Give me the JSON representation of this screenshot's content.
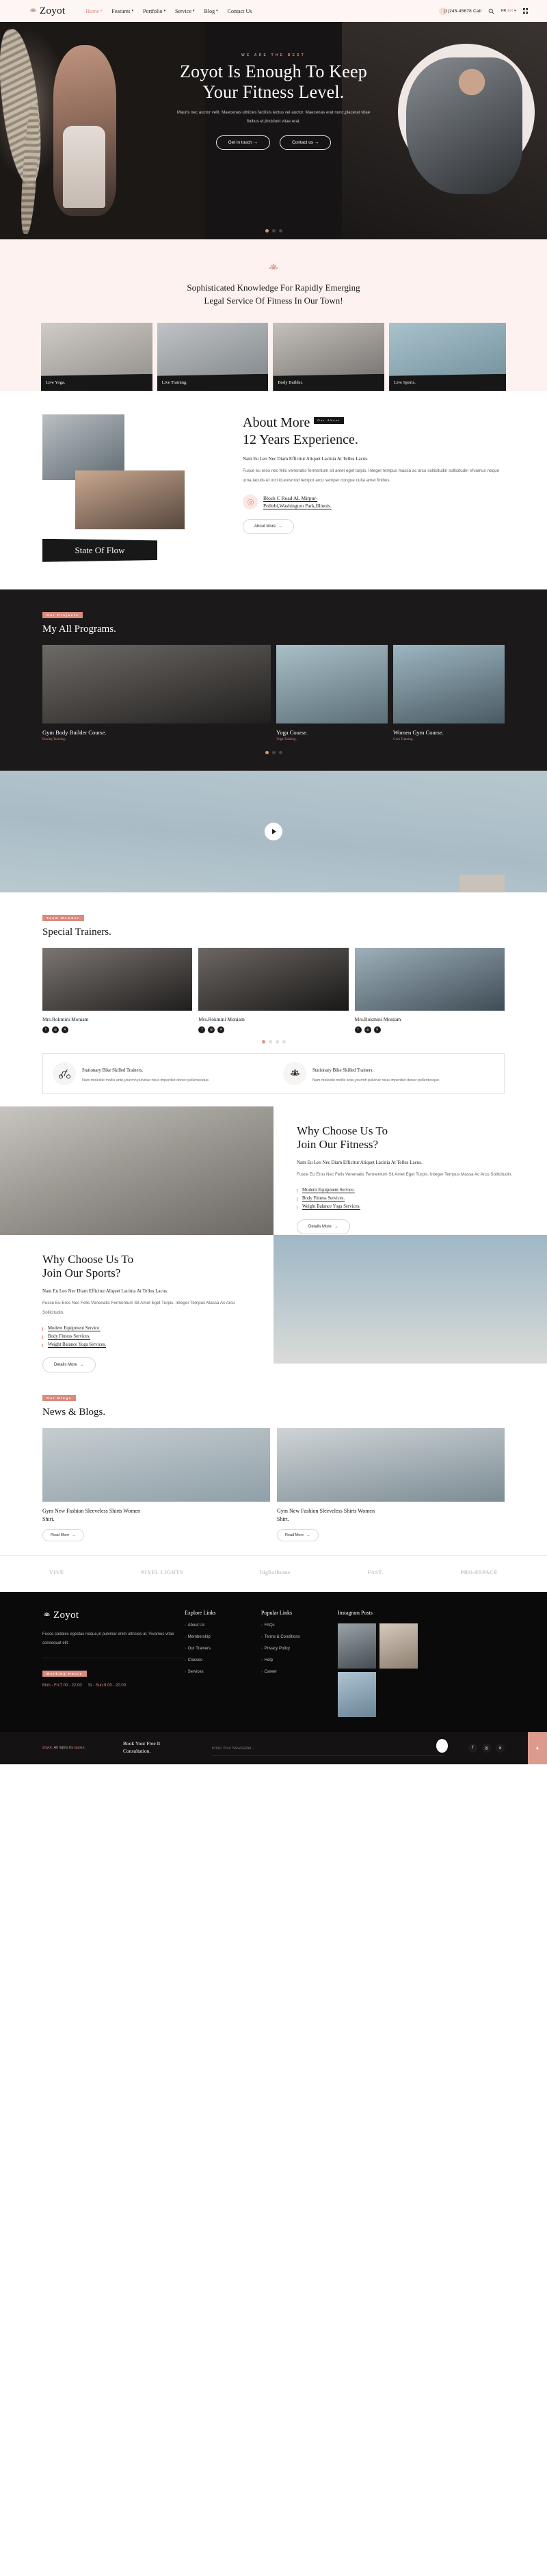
{
  "brand": {
    "name": "Zoyot",
    "logo_icon": "lotus-icon"
  },
  "header": {
    "nav": [
      {
        "label": "Home",
        "caret": "▾",
        "active": true
      },
      {
        "label": "Features",
        "caret": "▾",
        "active": false
      },
      {
        "label": "Portfolio",
        "caret": "▾",
        "active": false
      },
      {
        "label": "Service",
        "caret": "▾",
        "active": false
      },
      {
        "label": "Blog",
        "caret": "▾",
        "active": false
      },
      {
        "label": "Contact Us",
        "caret": "",
        "active": false
      }
    ],
    "phone": "(1)245-45678 Call",
    "search_icon": "search-icon",
    "lang_primary": "FR",
    "lang_secondary": "EN",
    "lang_caret": "▾",
    "grid_icon": "grid-menu-icon"
  },
  "hero": {
    "eyebrow": "WE ARE THE BEST",
    "title_line1": "Zoyot Is Enough To Keep",
    "title_line2": "Your Fitness Level.",
    "subtitle": "Mauris nec auctor velit. Maecenas ultricies facilisis lectus vel auctor. Maecenas erat nunc,placerat vitae finibus et,tincidunt vitae erat.",
    "btn_primary": "Get in touch",
    "btn_secondary": "Contact us",
    "arrow": "→",
    "slides": 3,
    "active_slide": 0
  },
  "knowledge": {
    "icon": "lotus-icon",
    "title_line1": "Sophisticated Knowledge For Rapidly Emerging",
    "title_line2": "Legal Service Of Fitness In Our Town!",
    "cards": [
      {
        "label": "Live Yoga."
      },
      {
        "label": "Live Training."
      },
      {
        "label": "Body Builder."
      },
      {
        "label": "Live Sports."
      }
    ]
  },
  "about": {
    "heading_line1": "About More",
    "chip": "Our About",
    "heading_line2": "12 Years Experience.",
    "lead": "Nam Eu Leo Nec Diam Efficitur Aliquet Lacinia At Tellus Lacus.",
    "paragraph": "Fusce eu eros nec felis venenatis fermentum sit amet eget turpis. Integer tempus massa ac arcu sollicitudin sollicitudin Vivamus neque urna,Iaculis et orci id,euismod tempor arcu semper congue nulla amet finibus.",
    "address_icon": "location-send-icon",
    "address_line1": "Block C Road AL Mirpur-",
    "address_line2": "Pollobi,Washington Park,Illinois.",
    "button": "About More",
    "arrow": "→",
    "badge": "State Of Flow"
  },
  "programs": {
    "chip": "Our Projects",
    "title": "My All Programs.",
    "cards": [
      {
        "name": "Gym Body Builder Course.",
        "sub": "Boxing Training."
      },
      {
        "name": "Yoga Course.",
        "sub": "Yoga Training."
      },
      {
        "name": "Women Gym Course.",
        "sub": "Gym Training."
      }
    ],
    "slides": 3,
    "active_slide": 0
  },
  "video": {
    "play_icon": "play-icon"
  },
  "trainers": {
    "chip": "Team Member",
    "title": "Special Trainers.",
    "cards": [
      {
        "name": "Mrs.Rokmini Moniam",
        "socials": [
          "f",
          "◎",
          "✕"
        ]
      },
      {
        "name": "Mrs.Rokmini Moniam",
        "socials": [
          "f",
          "◎",
          "✕"
        ]
      },
      {
        "name": "Mrs.Rokmini Moniam",
        "socials": [
          "f",
          "◎",
          "✕"
        ]
      }
    ],
    "slides": 4,
    "active_slide": 0,
    "features": [
      {
        "icon": "stationary-bike-icon",
        "title": "Stationary Bike Skilled Trainers.",
        "text": "Nam molestie mollis ante,yourmh pulvinar risus imperdiet donec pellentesque."
      },
      {
        "icon": "lotus-icon",
        "title": "Stationary Bike Skilled Trainers.",
        "text": "Nam molestie mollis ante,yourmh pulvinar risus imperdiet donec pellentesque."
      }
    ]
  },
  "why_sections": [
    {
      "heading_line1": "Why Choose Us To",
      "heading_line2": "Join Our Fitness?",
      "lead": "Nam Eu Leo Nec Diam Efficitur Aliquet Lacinia At Tellus Lacus.",
      "paragraph": "Fusce Eu Eros Nec Felis Venenatis Fermentum Sit Amet Eget Turpis. Integer Tempus Massa Ac Arcu Sollicitudin.",
      "items": [
        "Modern Equipment Service.",
        "Body Fitness Services.",
        "Weight Balance Yoga Services."
      ],
      "button": "Details More",
      "arrow": "→"
    },
    {
      "heading_line1": "Why Choose Us To",
      "heading_line2": "Join Our Sports?",
      "lead": "Nam Eu Leo Nec Diam Efficitur Aliquet Lacinia At Tellus Lacus.",
      "paragraph": "Fusce Eu Eros Nec Felis Venenatis Fermentum Sit Amet Eget Turpis. Integer Tempus Massa Ac Arcu Sollicitudin.",
      "items": [
        "Modern Equipment Service.",
        "Body Fitness Services.",
        "Weight Balance Yoga Services."
      ],
      "button": "Details More",
      "arrow": "→"
    }
  ],
  "blogs": {
    "chip": "Our Blogs",
    "title": "News & Blogs.",
    "posts": [
      {
        "title_line1": "Gym New Fashion Sleeveless Shirts Women",
        "title_line2": "Shirt.",
        "button": "Read More",
        "arrow": "→"
      },
      {
        "title_line1": "Gym New Fashion Sleeveless Shirts Women",
        "title_line2": "Shirt.",
        "button": "Read More",
        "arrow": "→"
      }
    ]
  },
  "partners": [
    "VIVE",
    "PIXEL LIGHTS",
    "bigbathome",
    "FAST.",
    "PRO-ESPACE"
  ],
  "footer": {
    "description": "Fusce sodales egestas neque,in pulvinar enim ultricies at. Vivamus vitae consequat elit.",
    "hours_chip": "Working Hours",
    "hours": [
      "Mon - Fri:7.00 - 22.00",
      "St - Sun:9.00 - 20.00"
    ],
    "explore_title": "Explore Links",
    "explore_links": [
      "About Us",
      "Membership",
      "Our Trainers",
      "Classes",
      "Services"
    ],
    "popular_title": "Popular Links",
    "popular_links": [
      "FAQs",
      "Terms & Conditions",
      "Privacy Policy",
      "Help",
      "Career"
    ],
    "instagram_title": "Instagram Posts",
    "copyright_pre": "Zoyot.",
    "copyright_mid": " All rights by ",
    "copyright_link": "rpaxui.",
    "book_line1": "Book Your Free It",
    "book_line2": "Consultation.",
    "newsletter_placeholder": "Enter Your Newslatter...",
    "socials": [
      "f",
      "◎",
      "✕"
    ],
    "to_top": "▲"
  }
}
